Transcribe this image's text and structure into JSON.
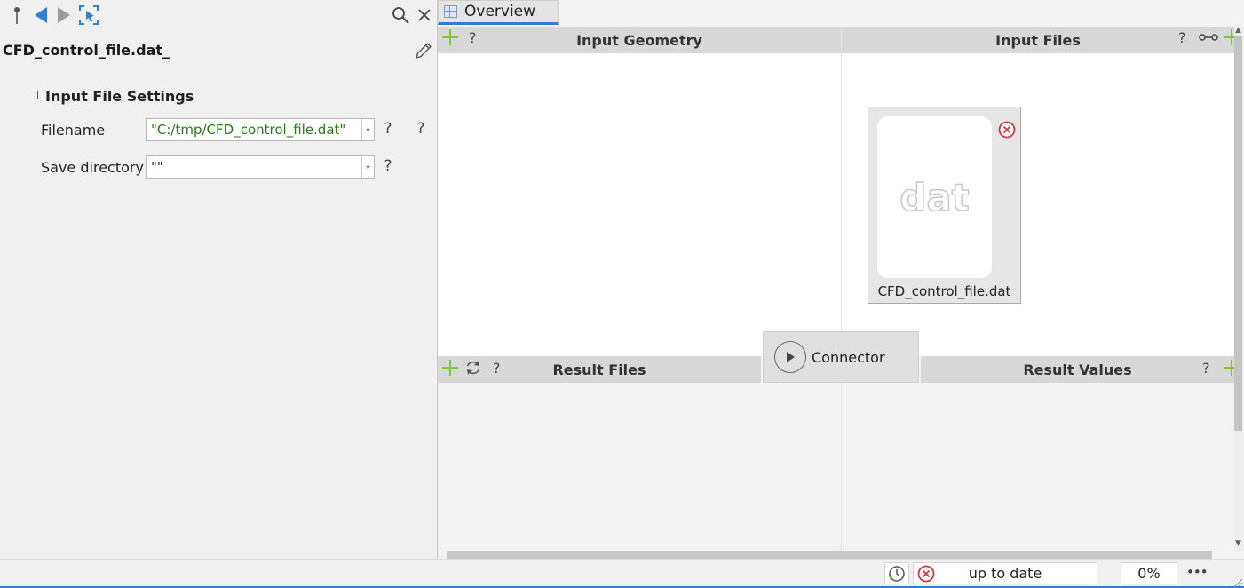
{
  "inspector": {
    "file_title": "CFD_control_file.dat_",
    "section_title": "Input File Settings",
    "fields": [
      {
        "label": "Filename",
        "value": "\"C:/tmp/CFD_control_file.dat\"",
        "help": "?",
        "help2": "?"
      },
      {
        "label": "Save directory",
        "value": "\"\"",
        "help": "?"
      }
    ]
  },
  "tabs": [
    {
      "label": "Overview"
    }
  ],
  "panels": {
    "input_geometry": {
      "title": "Input Geometry",
      "help": "?"
    },
    "input_files": {
      "title": "Input Files",
      "help": "?"
    },
    "result_files": {
      "title": "Result Files",
      "help": "?"
    },
    "result_values": {
      "title": "Result Values",
      "help": "?"
    }
  },
  "file_card": {
    "icon_text": "dat",
    "name": "CFD_control_file.dat"
  },
  "connector": {
    "label": "Connector"
  },
  "status": {
    "state": "up to date",
    "progress": "0%",
    "more": "•••"
  },
  "colors": {
    "accent": "#2f7fd4",
    "add": "#7cc63a",
    "error": "#d9353a",
    "value_text": "#2a7a1a"
  }
}
